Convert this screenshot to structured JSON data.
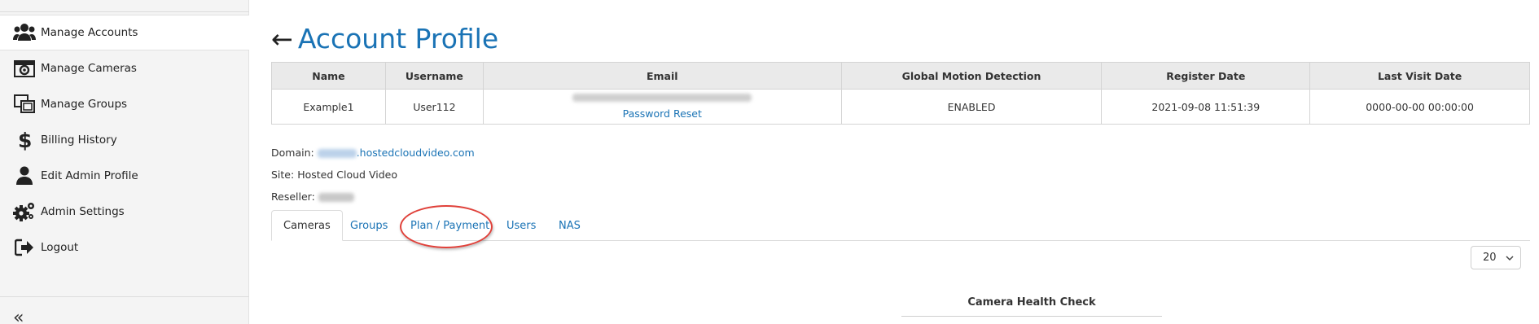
{
  "sidebar": {
    "items": [
      {
        "label": "Manage Accounts",
        "icon": "users-icon",
        "active": true
      },
      {
        "label": "Manage Cameras",
        "icon": "camera-icon"
      },
      {
        "label": "Manage Groups",
        "icon": "groups-icon"
      },
      {
        "label": "Billing History",
        "icon": "dollar-icon"
      },
      {
        "label": "Edit Admin Profile",
        "icon": "user-icon"
      },
      {
        "label": "Admin Settings",
        "icon": "gears-icon"
      },
      {
        "label": "Logout",
        "icon": "logout-icon"
      }
    ],
    "collapse_label": "«"
  },
  "page": {
    "back_arrow": "←",
    "title": "Account Profile"
  },
  "profile_table": {
    "headers": [
      "Name",
      "Username",
      "Email",
      "Global Motion Detection",
      "Register Date",
      "Last Visit Date"
    ],
    "row": {
      "name": "Example1",
      "username": "User112",
      "email_link": "Password Reset",
      "motion_detection": "ENABLED",
      "register_date": "2021-09-08 11:51:39",
      "last_visit_date": "0000-00-00 00:00:00"
    }
  },
  "info": {
    "domain_label": "Domain:",
    "domain_suffix": ".hostedcloudvideo.com",
    "site_label": "Site:",
    "site_value": "Hosted Cloud Video",
    "reseller_label": "Reseller:"
  },
  "tabs": [
    {
      "label": "Cameras",
      "active": true
    },
    {
      "label": "Groups"
    },
    {
      "label": "Plan / Payment",
      "highlighted": true
    },
    {
      "label": "Users"
    },
    {
      "label": "NAS"
    }
  ],
  "page_size": {
    "selected": "20"
  },
  "camera_health": {
    "title": "Camera Health Check"
  },
  "colors": {
    "accent": "#1a73b5",
    "enabled": "#22b422",
    "highlight": "#e0413a"
  }
}
